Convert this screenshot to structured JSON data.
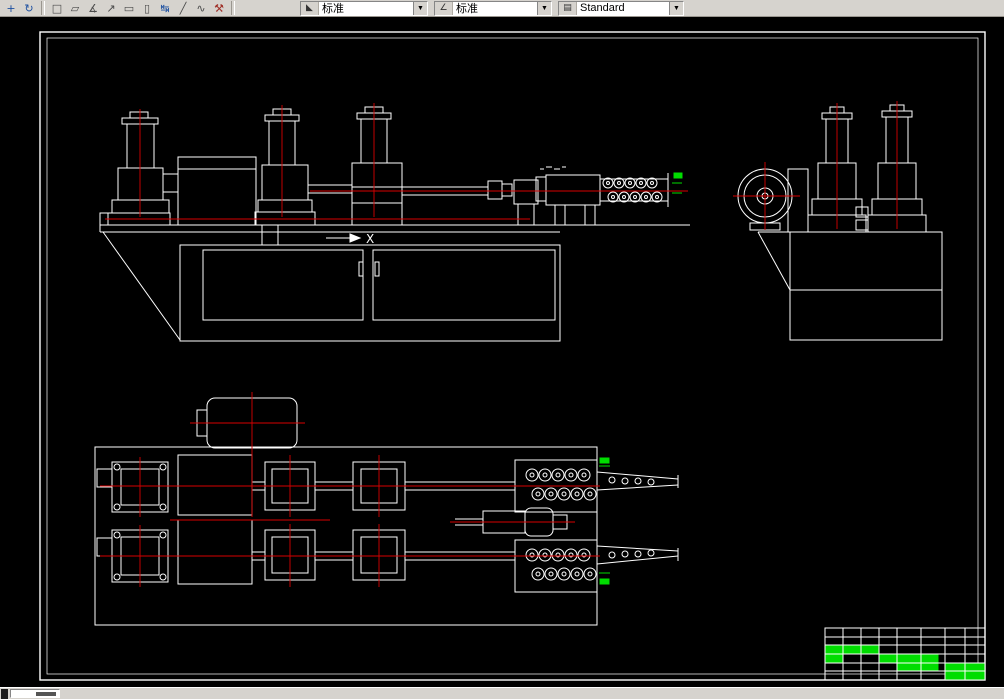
{
  "colors": {
    "toolbar-bg": "#d6d3ce",
    "icon-blue": "#1c4fa0",
    "icon-red": "#a03028",
    "canvas-bg": "#000000",
    "line-white": "#ffffff",
    "line-red": "#d80000",
    "line-green": "#00dd00"
  },
  "toolbar": {
    "icons": [
      {
        "name": "pan-icon",
        "glyph": "+"
      },
      {
        "name": "orbit-icon",
        "glyph": "↻"
      },
      {
        "name": "zoom-window-icon",
        "glyph": "□"
      },
      {
        "name": "polygon-icon",
        "glyph": "▱"
      },
      {
        "name": "angle-icon",
        "glyph": "∡"
      },
      {
        "name": "leader-icon",
        "glyph": "↗"
      },
      {
        "name": "rectangle-icon",
        "glyph": "▭"
      },
      {
        "name": "viewport-icon",
        "glyph": "▯"
      },
      {
        "name": "stretch-icon",
        "glyph": "↹"
      },
      {
        "name": "line-icon",
        "glyph": "╱"
      },
      {
        "name": "spline-icon",
        "glyph": "∿"
      },
      {
        "name": "tools-icon",
        "glyph": "⚒"
      }
    ],
    "combos": [
      {
        "name": "text-style-combo",
        "icon_glyph": "◣",
        "value": "标准"
      },
      {
        "name": "dim-style-combo",
        "icon_glyph": "∠",
        "value": "标准"
      },
      {
        "name": "table-style-combo",
        "icon_glyph": "▤",
        "value": "Standard"
      }
    ],
    "dropdown_arrow": "▼"
  },
  "drawing": {
    "section_mark": "X"
  }
}
